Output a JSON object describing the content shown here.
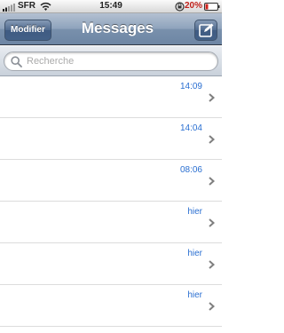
{
  "status_bar": {
    "carrier": "SFR",
    "time": "15:49",
    "battery": "20%"
  },
  "nav": {
    "edit_label": "Modifier",
    "title": "Messages"
  },
  "search": {
    "placeholder": "Recherche"
  },
  "messages": [
    {
      "time": "14:09"
    },
    {
      "time": "14:04"
    },
    {
      "time": "08:06"
    },
    {
      "time": "hier"
    },
    {
      "time": "hier"
    },
    {
      "time": "hier"
    }
  ],
  "colors": {
    "accent_time": "#2a6fd1",
    "battery_low": "#c0211b",
    "nav_bar": "#7990ac"
  },
  "icons": [
    "signal-icon",
    "wifi-icon",
    "lock-rotation-icon",
    "battery-icon",
    "compose-icon",
    "search-icon",
    "chevron-right-icon"
  ]
}
